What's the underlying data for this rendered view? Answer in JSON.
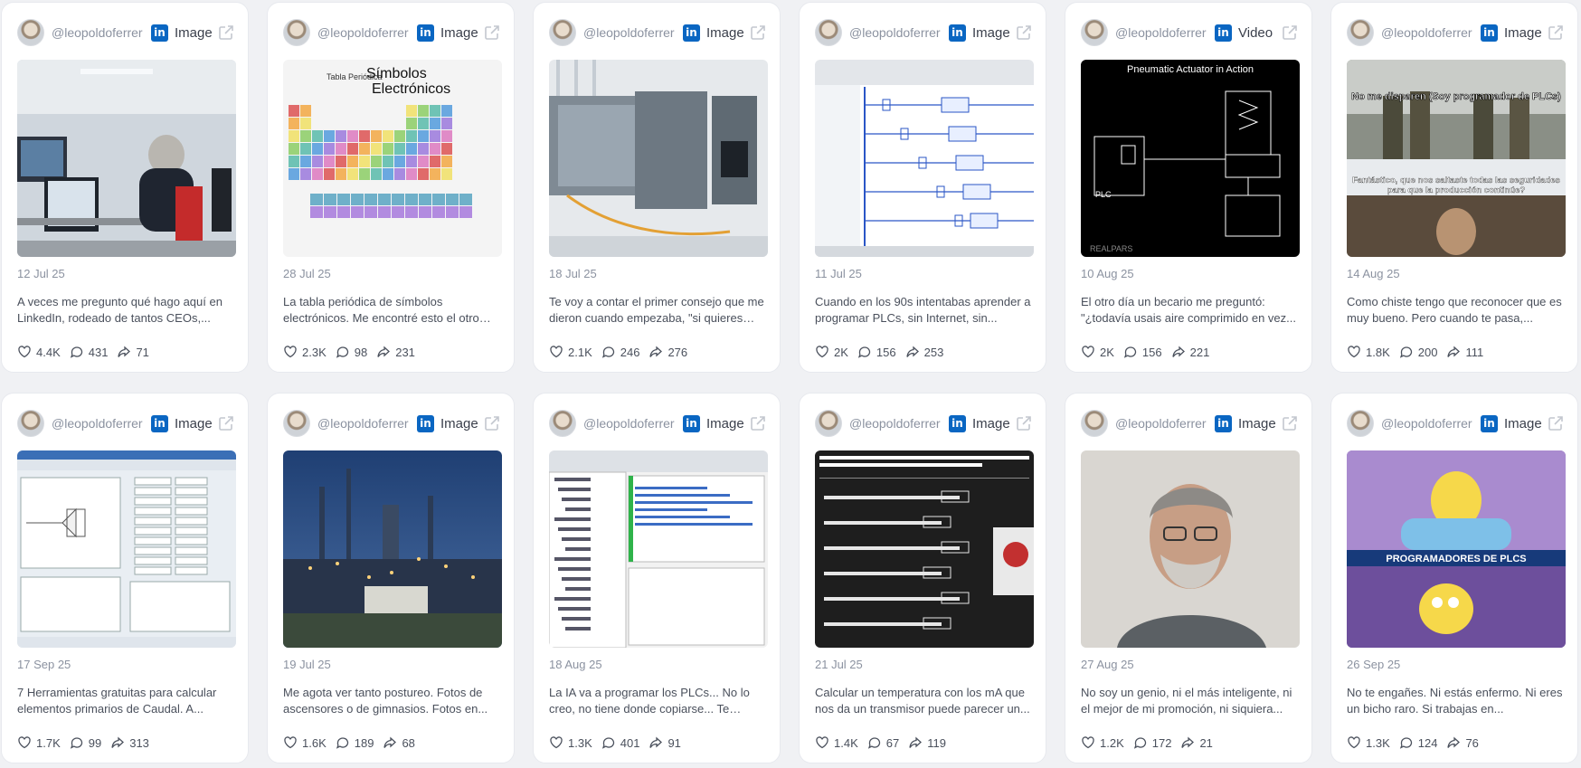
{
  "cards": [
    {
      "handle": "@leopoldoferrer",
      "type": "Image",
      "date": "12 Jul 25",
      "text": "A veces me pregunto qué hago aquí en LinkedIn, rodeado de tantos CEOs,...",
      "likes": "4.4K",
      "comments": "431",
      "shares": "71",
      "thumb": "control-room-photo"
    },
    {
      "handle": "@leopoldoferrer",
      "type": "Image",
      "date": "28 Jul 25",
      "text": "La tabla periódica de símbolos electrónicos. Me encontré esto el otro dí...",
      "likes": "2.3K",
      "comments": "98",
      "shares": "231",
      "thumb": "periodic-table",
      "thumb_text": {
        "small": "Tabla Periódica",
        "big1": "Símbolos",
        "big2": "Electrónicos"
      }
    },
    {
      "handle": "@leopoldoferrer",
      "type": "Image",
      "date": "18 Jul 25",
      "text": "Te voy a contar el primer consejo que me dieron cuando empezaba, \"si quieres se...",
      "likes": "2.1K",
      "comments": "246",
      "shares": "276",
      "thumb": "plc-hardware-photo"
    },
    {
      "handle": "@leopoldoferrer",
      "type": "Image",
      "date": "11 Jul 25",
      "text": "Cuando en los 90s intentabas aprender a programar PLCs, sin Internet, sin...",
      "likes": "2K",
      "comments": "156",
      "shares": "253",
      "thumb": "ladder-logic-screenshot"
    },
    {
      "handle": "@leopoldoferrer",
      "type": "Video",
      "date": "10 Aug 25",
      "text": "El otro día un becario me preguntó: \"¿todavía usais aire comprimido en vez...",
      "likes": "2K",
      "comments": "156",
      "shares": "221",
      "thumb": "pneumatic-diagram",
      "thumb_text": {
        "title": "Pneumatic Actuator in Action",
        "plc": "PLC",
        "brand": "REALPARS"
      }
    },
    {
      "handle": "@leopoldoferrer",
      "type": "Image",
      "date": "14 Aug 25",
      "text": "Como chiste tengo que reconocer que es muy bueno. Pero cuando te pasa,...",
      "likes": "1.8K",
      "comments": "200",
      "shares": "111",
      "thumb": "soldiers-meme",
      "thumb_text": {
        "top": "No me disparen (Soy programador de PLCs)",
        "bottom": "Fantástico, que nos saltaste todas las seguridades para que la producción continúe?"
      }
    },
    {
      "handle": "@leopoldoferrer",
      "type": "Image",
      "date": "17 Sep 25",
      "text": "7 Herramientas gratuitas para calcular elementos primarios de Caudal. A...",
      "likes": "1.7K",
      "comments": "99",
      "shares": "313",
      "thumb": "flow-calculator-screenshot"
    },
    {
      "handle": "@leopoldoferrer",
      "type": "Image",
      "date": "19 Jul 25",
      "text": "Me agota ver tanto postureo. Fotos de ascensores o de gimnasios. Fotos en...",
      "likes": "1.6K",
      "comments": "189",
      "shares": "68",
      "thumb": "refinery-night-photo"
    },
    {
      "handle": "@leopoldoferrer",
      "type": "Image",
      "date": "18 Aug 25",
      "text": "La IA va a programar los PLCs... No lo creo, no tiene donde copiarse... Te explic...",
      "likes": "1.3K",
      "comments": "401",
      "shares": "91",
      "thumb": "ide-code-screenshot"
    },
    {
      "handle": "@leopoldoferrer",
      "type": "Image",
      "date": "21 Jul 25",
      "text": "Calcular un temperatura con los mA que nos da un transmisor puede parecer un...",
      "likes": "1.4K",
      "comments": "67",
      "shares": "119",
      "thumb": "formula-blackboard"
    },
    {
      "handle": "@leopoldoferrer",
      "type": "Image",
      "date": "27 Aug 25",
      "text": "No soy un genio, ni el más inteligente, ni el mejor de mi promoción, ni siquiera...",
      "likes": "1.2K",
      "comments": "172",
      "shares": "21",
      "thumb": "portrait-photo"
    },
    {
      "handle": "@leopoldoferrer",
      "type": "Image",
      "date": "26 Sep 25",
      "text": "No te engañes. Ni estás enfermo. Ni eres un bicho raro. Si trabajas en...",
      "likes": "1.3K",
      "comments": "124",
      "shares": "76",
      "thumb": "simpsons-meme",
      "thumb_text": {
        "banner": "PROGRAMADORES DE PLCS"
      }
    }
  ],
  "colors": {
    "linkedin": "#0a66c2",
    "background": "#f0f1f4",
    "card": "#ffffff"
  }
}
